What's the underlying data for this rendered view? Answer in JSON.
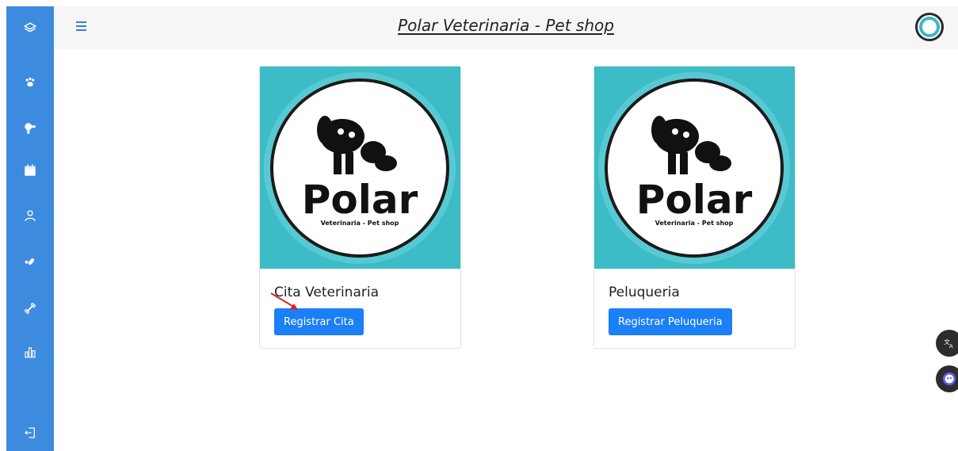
{
  "header": {
    "title": "Polar Veterinaria - Pet shop"
  },
  "sidebar": {
    "icons": [
      "layers-icon",
      "paw-icon",
      "hair-dryer-icon",
      "calendar-icon",
      "user-icon",
      "pills-icon",
      "bone-icon",
      "bar-chart-icon",
      "logout-icon"
    ]
  },
  "cards": [
    {
      "title": "Cita Veterinaria",
      "button_label": "Registrar Cita",
      "logo_text": "Polar",
      "logo_subtext": "Veterinaria - Pet shop"
    },
    {
      "title": "Peluqueria",
      "button_label": "Registrar Peluqueria",
      "logo_text": "Polar",
      "logo_subtext": "Veterinaria - Pet shop"
    }
  ],
  "colors": {
    "sidebar": "#3d8bdf",
    "button": "#1b7ff5",
    "logo_bg": "#3bbcc7",
    "annotation_arrow": "#e02020"
  }
}
